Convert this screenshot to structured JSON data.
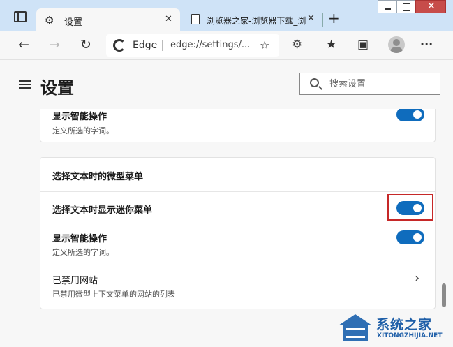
{
  "tabs": {
    "active_label": "设置",
    "inactive_label": "浏览器之家-浏览器下载_浏",
    "close_glyph": "✕",
    "new_tab_glyph": "+"
  },
  "window_controls": {
    "close_glyph": "✕"
  },
  "toolbar": {
    "back_glyph": "←",
    "forward_glyph": "→",
    "refresh_glyph": "↻",
    "brand": "Edge",
    "url": "edge://settings/...",
    "favorite_glyph": "☆",
    "extensions_glyph": "⚙",
    "favorites_glyph": "★",
    "collections_glyph": "▣",
    "more_glyph": "···"
  },
  "header": {
    "title": "设置",
    "search_placeholder": "搜索设置"
  },
  "sections": {
    "top_card": {
      "row_title": "显示智能操作",
      "row_desc": "定义所选的字词。",
      "toggle_on": true
    },
    "mini_menu_card": {
      "heading": "选择文本时的微型菜单",
      "rows": [
        {
          "title": "选择文本时显示迷你菜单",
          "toggle_on": true,
          "highlighted": true
        },
        {
          "title": "显示智能操作",
          "desc": "定义所选的字词。",
          "toggle_on": true
        },
        {
          "title": "已禁用网站",
          "desc": "已禁用微型上下文菜单的网站的列表",
          "chevron": "›"
        }
      ]
    }
  },
  "watermark": {
    "title": "系统之家",
    "subtitle": "XITONGZHIJIA.NET"
  },
  "colors": {
    "accent": "#0f6cbd",
    "highlight_box": "#c62828",
    "chrome_bg": "#cfe3f7",
    "close_btn": "#c74c4a"
  }
}
